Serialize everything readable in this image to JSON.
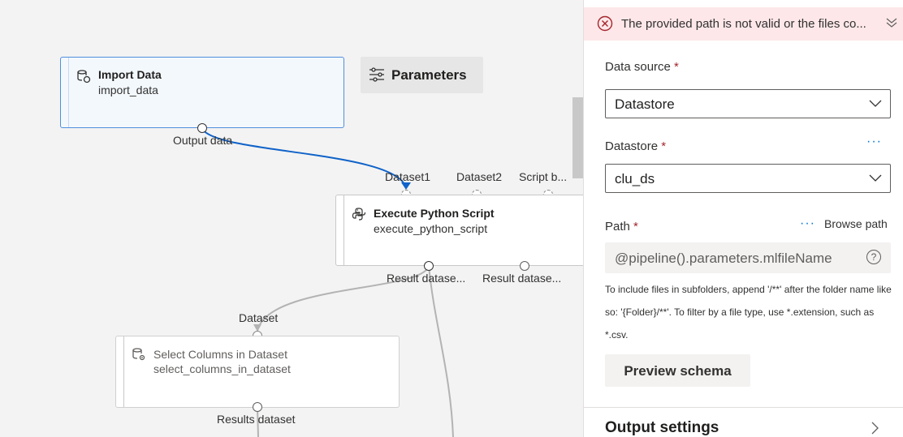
{
  "canvas": {
    "import_node": {
      "title": "Import Data",
      "subtitle": "import_data",
      "output_port": "Output data"
    },
    "parameters_button": {
      "label": "Parameters"
    },
    "exec_node": {
      "title": "Execute Python Script",
      "subtitle": "execute_python_script",
      "inputs": [
        "Dataset1",
        "Dataset2",
        "Script b..."
      ],
      "outputs": [
        "Result datase...",
        "Result datase..."
      ]
    },
    "select_node": {
      "title": "Select Columns in Dataset",
      "subtitle": "select_columns_in_dataset",
      "input_port": "Dataset",
      "output_port": "Results dataset"
    }
  },
  "panel": {
    "error": {
      "message": "The provided path is not valid or the files co..."
    },
    "data_source": {
      "label": "Data source",
      "required": "*",
      "value": "Datastore"
    },
    "datastore": {
      "label": "Datastore",
      "required": "*",
      "value": "clu_ds",
      "more": "···"
    },
    "path": {
      "label": "Path",
      "required": "*",
      "browse": "Browse path",
      "more": "···",
      "value": "@pipeline().parameters.mlfileName",
      "help": "?",
      "hint": "To include files in subfolders, append '/**' after the folder name like so: '{Folder}/**'. To filter by a file type, use *.extension, such as *.csv."
    },
    "preview_button": "Preview schema",
    "output_settings": "Output settings"
  },
  "colors": {
    "accent": "#0078d4",
    "error_bg": "#fde7e9",
    "error_icon": "#a4262c",
    "selected_border": "#4f8fdc"
  }
}
